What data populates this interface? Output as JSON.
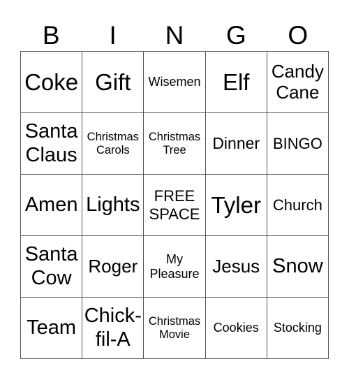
{
  "header": {
    "letters": [
      "B",
      "I",
      "N",
      "G",
      "O"
    ]
  },
  "cells": [
    [
      "Coke",
      "Gift",
      "Wisemen",
      "Elf",
      "Candy Cane"
    ],
    [
      "Santa Claus",
      "Christmas Carols",
      "Christmas Tree",
      "Dinner",
      "BINGO"
    ],
    [
      "Amen",
      "Lights",
      "FREE SPACE",
      "Tyler",
      "Church"
    ],
    [
      "Santa Cow",
      "Roger",
      "My Pleasure",
      "Jesus",
      "Snow"
    ],
    [
      "Team",
      "Chick-fil-A",
      "Christmas Movie",
      "Cookies",
      "Stocking"
    ]
  ]
}
